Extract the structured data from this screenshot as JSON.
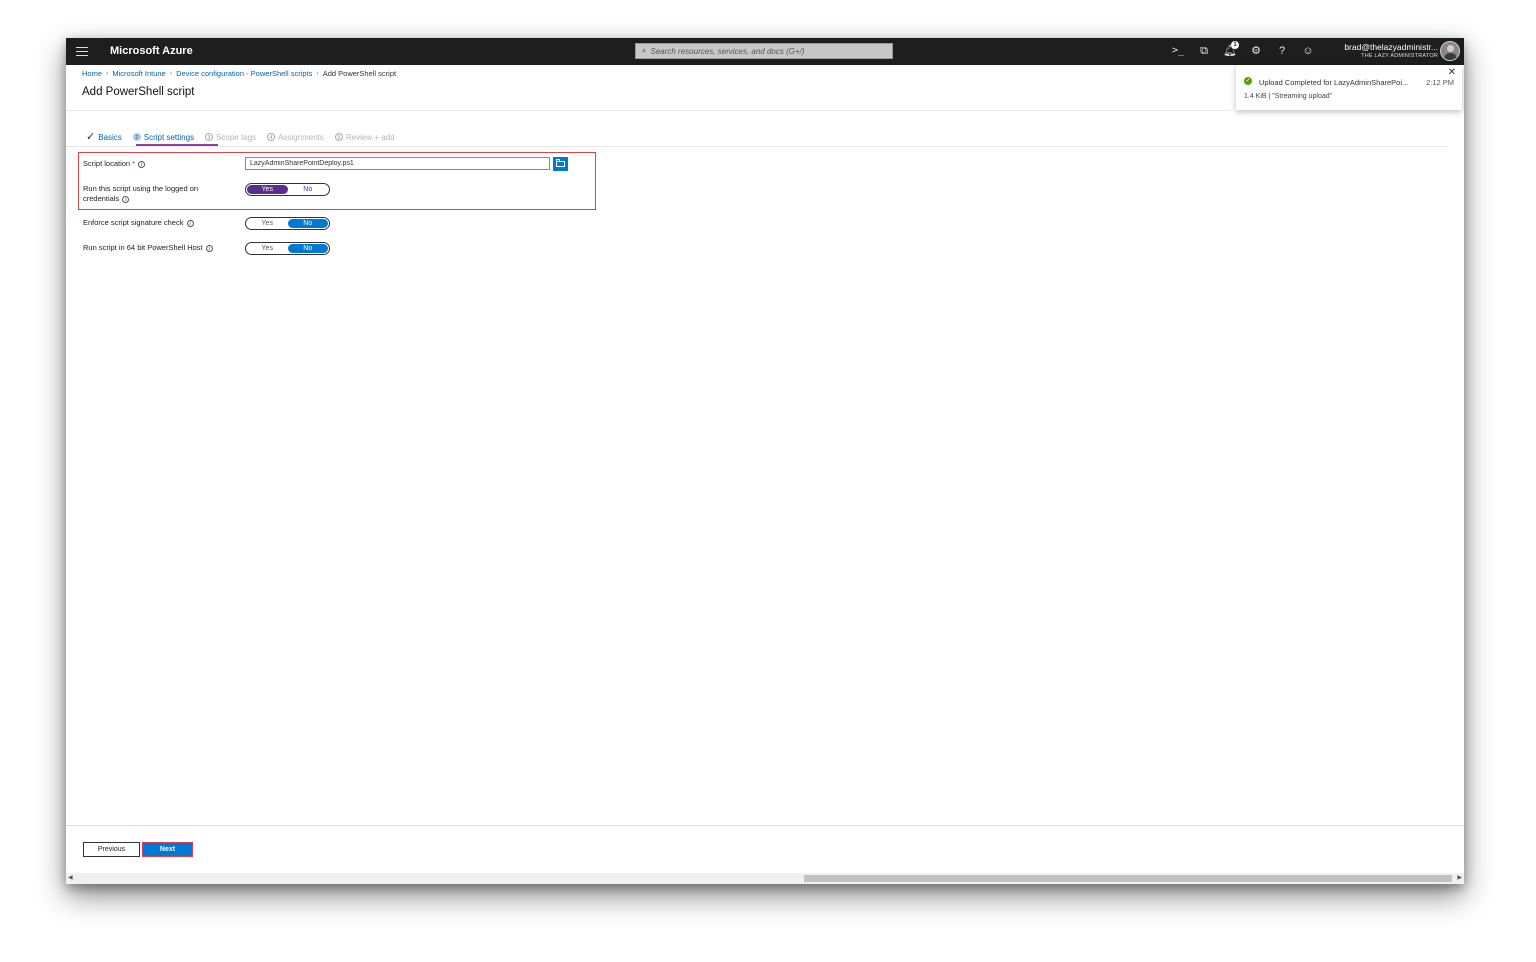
{
  "topbar": {
    "brand": "Microsoft Azure",
    "search_placeholder": "Search resources, services, and docs (G+/)",
    "notification_count": "1",
    "user_email": "brad@thelazyadministr...",
    "user_tenant": "THE LAZY ADMINISTRATOR",
    "icons": [
      "cloud-shell-icon",
      "directory-filter-icon",
      "notifications-icon",
      "settings-icon",
      "help-icon",
      "feedback-icon"
    ]
  },
  "breadcrumb": {
    "items": [
      "Home",
      "Microsoft Intune",
      "Device configuration - PowerShell scripts"
    ],
    "current": "Add PowerShell script"
  },
  "page": {
    "title": "Add PowerShell script"
  },
  "tabs": [
    {
      "label": "Basics",
      "state": "done"
    },
    {
      "number": "2",
      "label": "Script settings",
      "state": "active"
    },
    {
      "number": "3",
      "label": "Scope tags",
      "state": "disabled"
    },
    {
      "number": "4",
      "label": "Assignments",
      "state": "disabled"
    },
    {
      "number": "5",
      "label": "Review + add",
      "state": "disabled"
    }
  ],
  "form": {
    "script_location": {
      "label": "Script location",
      "required": "*",
      "value": "LazyAdminSharePointDeploy.ps1"
    },
    "run_logged_on": {
      "label_line1": "Run this script using the logged on",
      "label_line2": "credentials",
      "yes": "Yes",
      "no": "No",
      "selected": "Yes"
    },
    "signature_check": {
      "label": "Enforce script signature check",
      "yes": "Yes",
      "no": "No",
      "selected": "No"
    },
    "run_64bit": {
      "label": "Run script in 64 bit PowerShell Host",
      "yes": "Yes",
      "no": "No",
      "selected": "No"
    }
  },
  "toast": {
    "message": "Upload Completed for LazyAdminSharePoi...",
    "time": "2:12 PM",
    "detail": "1.4 KiB | \"Streaming upload\""
  },
  "footer": {
    "previous": "Previous",
    "next": "Next"
  },
  "colors": {
    "topbar": "#1e1e1e",
    "link": "#0063b1",
    "primary": "#0078d4",
    "toggle_purple": "#5c2d91",
    "highlight": "#e0404a",
    "success": "#57a300"
  }
}
